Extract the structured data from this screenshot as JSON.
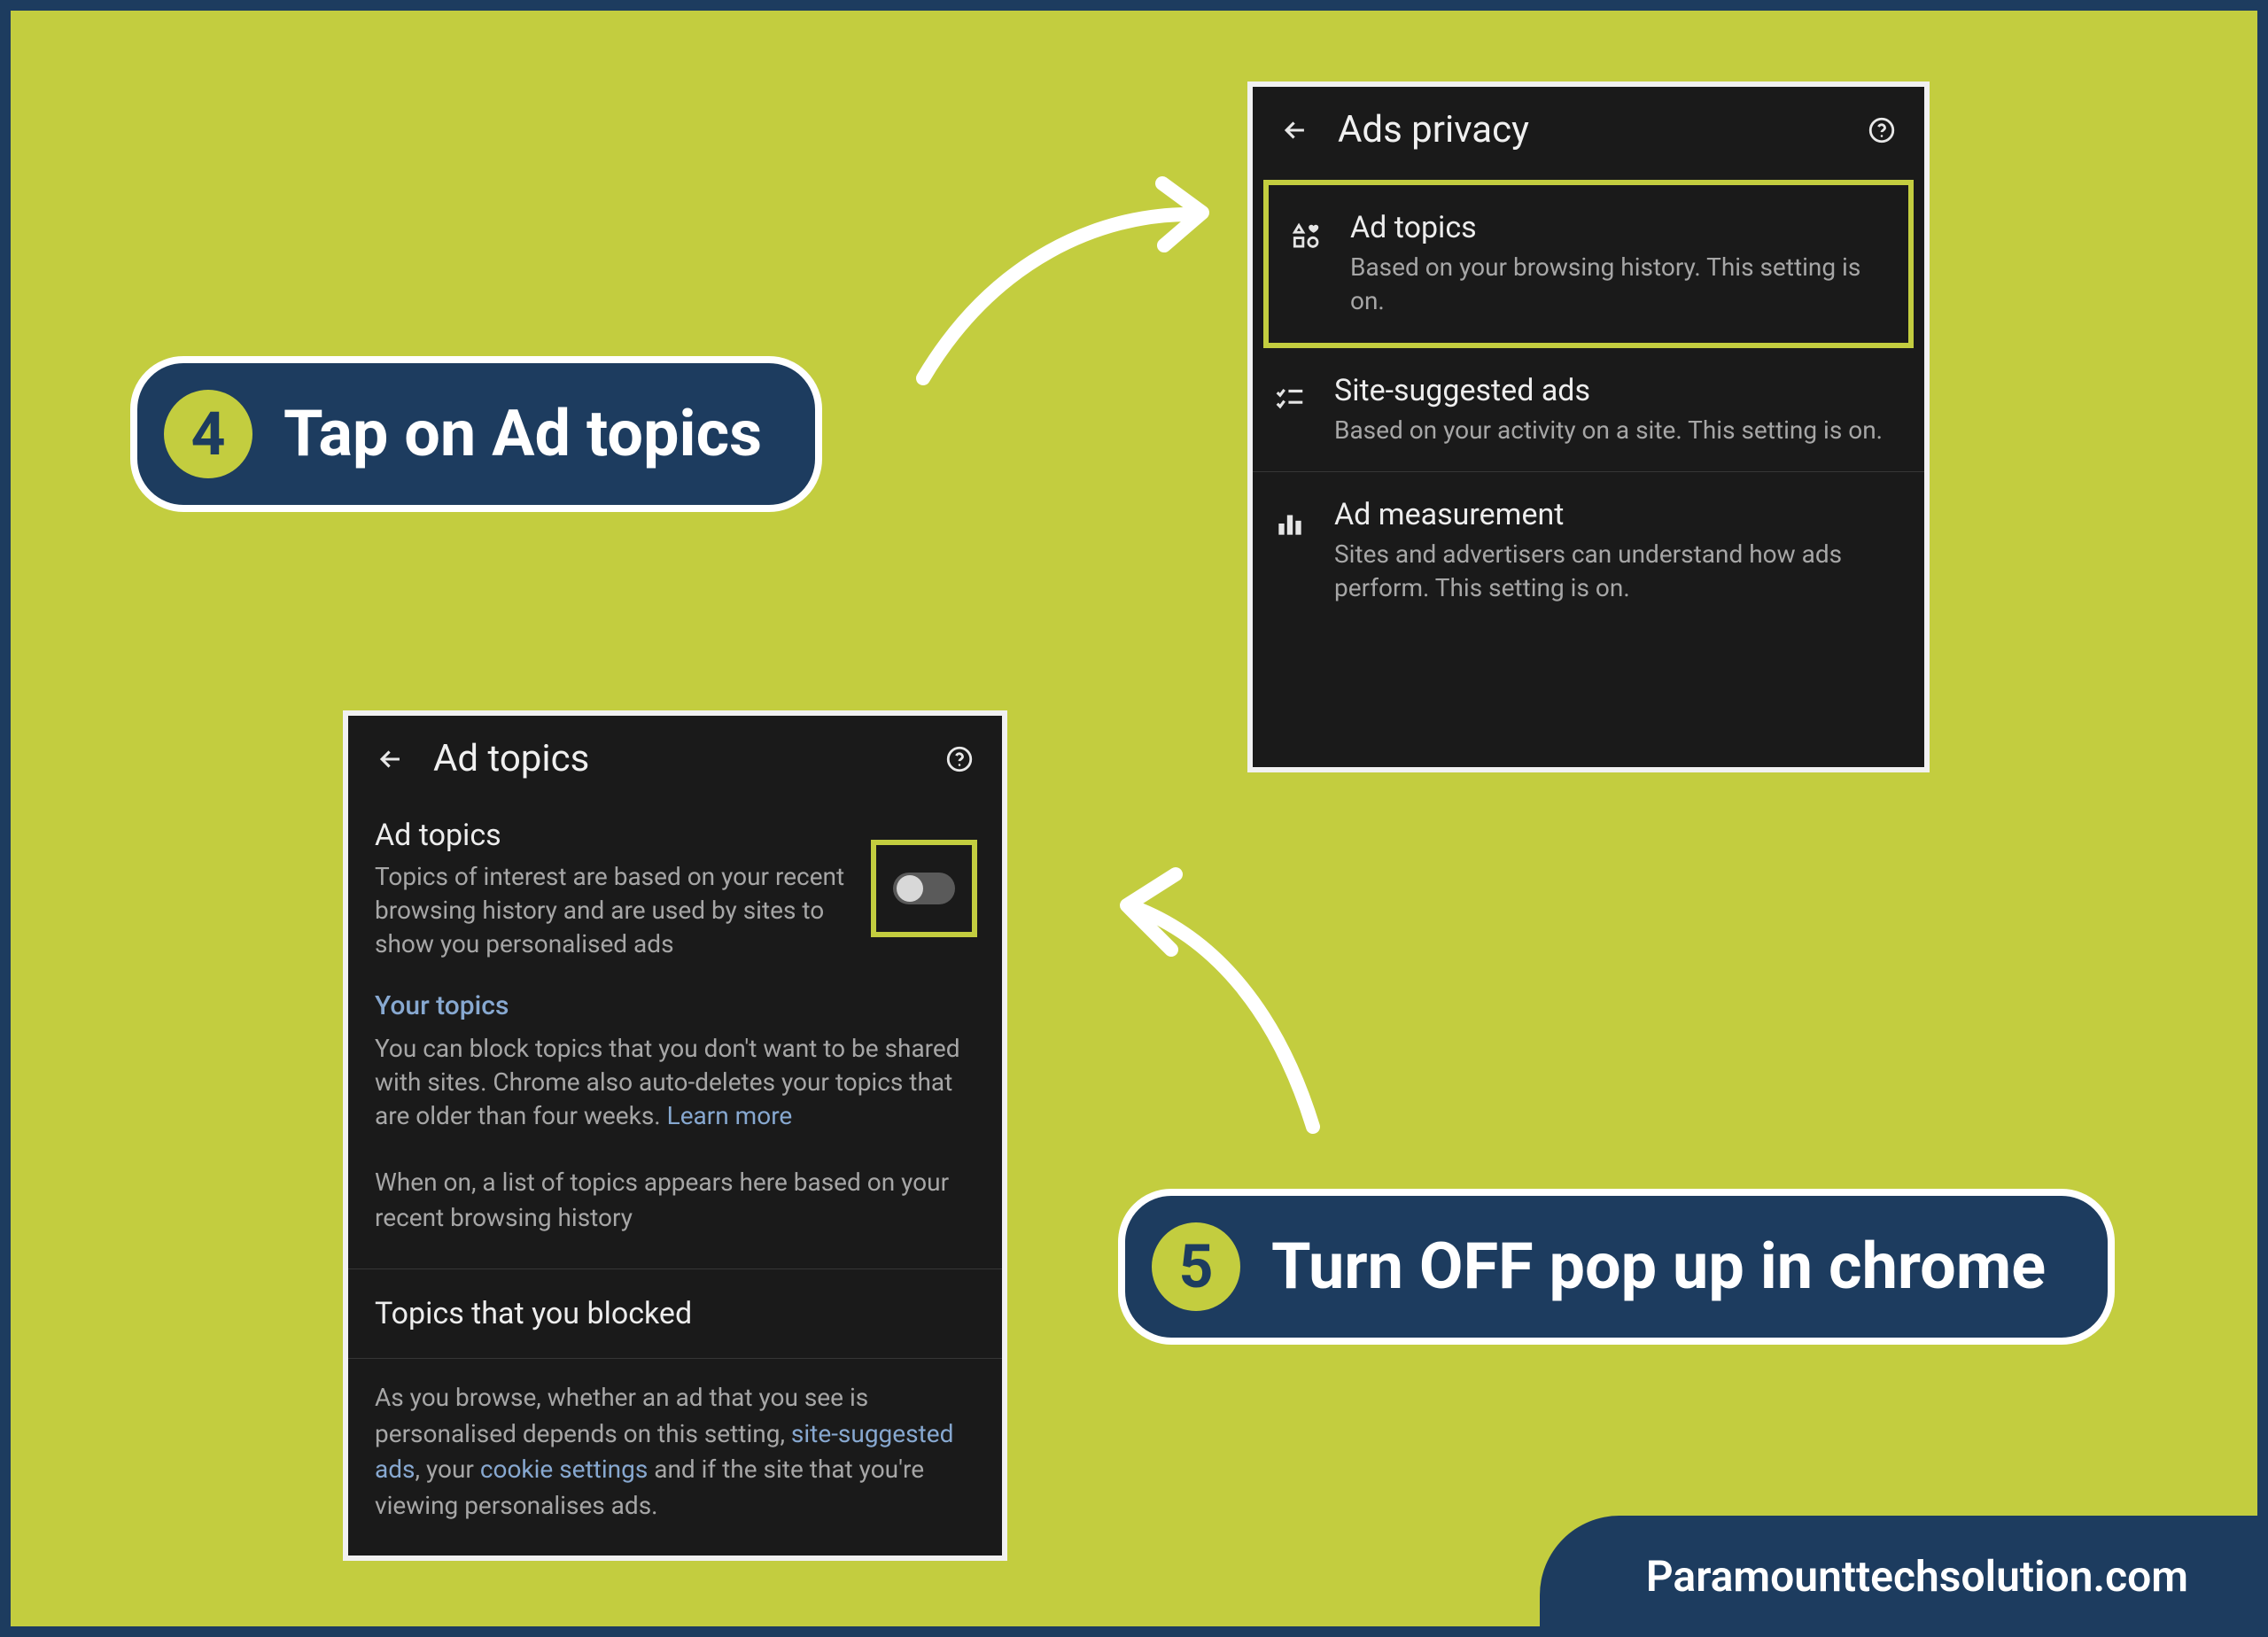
{
  "steps": {
    "step4": {
      "num": "4",
      "text": "Tap on Ad topics"
    },
    "step5": {
      "num": "5",
      "text": "Turn OFF pop up in chrome"
    }
  },
  "panel1": {
    "title": "Ads privacy",
    "rows": [
      {
        "title": "Ad topics",
        "desc": "Based on your browsing history. This setting is on."
      },
      {
        "title": "Site-suggested ads",
        "desc": "Based on your activity on a site. This setting is on."
      },
      {
        "title": "Ad measurement",
        "desc": "Sites and advertisers can understand how ads perform. This setting is on."
      }
    ]
  },
  "panel2": {
    "title": "Ad topics",
    "heading": "Ad topics",
    "desc": "Topics of interest are based on your recent browsing history and are used by sites to show you personalised ads",
    "yourTopics": "Your topics",
    "yourTopicsDesc": "You can block topics that you don't want to be shared with sites. Chrome also auto-deletes your topics that are older than four weeks. ",
    "learnMore": "Learn more",
    "whenOn": "When on, a list of topics appears here based on your recent browsing history",
    "blocked": "Topics that you blocked",
    "footer1": "As you browse, whether an ad that you see is personalised depends on this setting, ",
    "footerLink1": "site-suggested ads",
    "footer2": ", your ",
    "footerLink2": "cookie settings",
    "footer3": " and if the site that you're viewing personalises ads."
  },
  "brand": "Paramounttechsolution.com"
}
